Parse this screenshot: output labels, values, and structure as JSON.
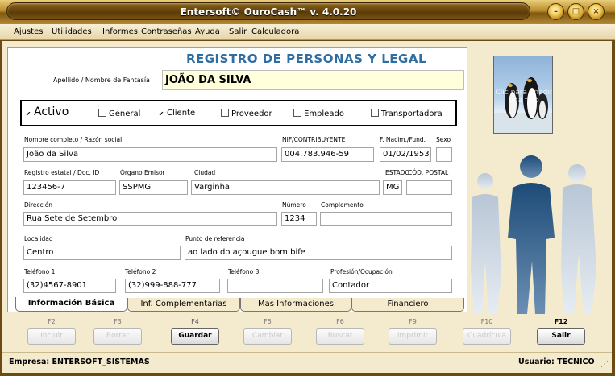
{
  "window": {
    "title": "Entersoft© OuroCash™ v. 4.0.20"
  },
  "menu": [
    "Ajustes",
    "Utilidades",
    "Informes",
    "Contraseñas",
    "Ayuda",
    "Salir",
    "Calculadora"
  ],
  "form": {
    "title": "REGISTRO DE PERSONAS Y LEGAL",
    "name_label": "Apellido / Nombre de Fantasía",
    "name_value": "JOÃO DA SILVA",
    "checks": [
      {
        "label": "Activo",
        "checked": true
      },
      {
        "label": "General",
        "checked": false
      },
      {
        "label": "Cliente",
        "checked": true
      },
      {
        "label": "Proveedor",
        "checked": false
      },
      {
        "label": "Empleado",
        "checked": false
      },
      {
        "label": "Transportadora",
        "checked": false
      }
    ],
    "fields": {
      "nombre_completo": {
        "label": "Nombre completo / Razón social",
        "value": "João da Silva"
      },
      "nif": {
        "label": "NIF/CONTRIBUYENTE",
        "value": "004.783.946-59"
      },
      "fnacim": {
        "label": "F. Nacim./Fund.",
        "value": "01/02/1953"
      },
      "sexo": {
        "label": "Sexo",
        "value": ""
      },
      "registro": {
        "label": "Registro estatal / Doc. ID",
        "value": "123456-7"
      },
      "organo": {
        "label": "Órgano Emisor",
        "value": "SSPMG"
      },
      "ciudad": {
        "label": "Ciudad",
        "value": "Varginha"
      },
      "estado": {
        "label": "ESTADO",
        "value": "MG"
      },
      "cod_postal": {
        "label": "CÓD. POSTAL",
        "value": ""
      },
      "direccion": {
        "label": "Dirección",
        "value": "Rua Sete de Setembro"
      },
      "numero": {
        "label": "Número",
        "value": "1234"
      },
      "complemento": {
        "label": "Complemento",
        "value": ""
      },
      "localidad": {
        "label": "Localidad",
        "value": "Centro"
      },
      "punto_ref": {
        "label": "Punto de referencia",
        "value": "ao lado do açougue bom bife"
      },
      "telefono1": {
        "label": "Teléfono 1",
        "value": "(32)4567-8901"
      },
      "telefono2": {
        "label": "Teléfono 2",
        "value": "(32)999-888-777"
      },
      "telefono3": {
        "label": "Teléfono 3",
        "value": ""
      },
      "profesion": {
        "label": "Profesión/Ocupación",
        "value": "Contador"
      }
    },
    "tabs": [
      "Información Básica",
      "Inf. Complementarias",
      "Mas Informaciones",
      "Financiero"
    ]
  },
  "photo": {
    "hint": "Clic para añadir una foto"
  },
  "fkeys": [
    {
      "key": "F2",
      "label": "Incluir",
      "enabled": false
    },
    {
      "key": "F3",
      "label": "Borrar",
      "enabled": false
    },
    {
      "key": "F4",
      "label": "Guardar",
      "enabled": true
    },
    {
      "key": "F5",
      "label": "Cambiar",
      "enabled": false
    },
    {
      "key": "F6",
      "label": "Buscar",
      "enabled": false
    },
    {
      "key": "F9",
      "label": "Imprimir",
      "enabled": false
    },
    {
      "key": "F10",
      "label": "Cuadrícula",
      "enabled": false
    },
    {
      "key": "F12",
      "label": "Salir",
      "enabled": true
    }
  ],
  "status": {
    "empresa": "Empresa: ENTERSOFT_SISTEMAS",
    "usuario": "Usuario: TECNICO"
  },
  "colors": {
    "title_blue": "#2f6ea3",
    "frame_gold": "#b98b2c",
    "client_bg": "#f4ebce",
    "name_input_bg": "#ffffdc"
  }
}
